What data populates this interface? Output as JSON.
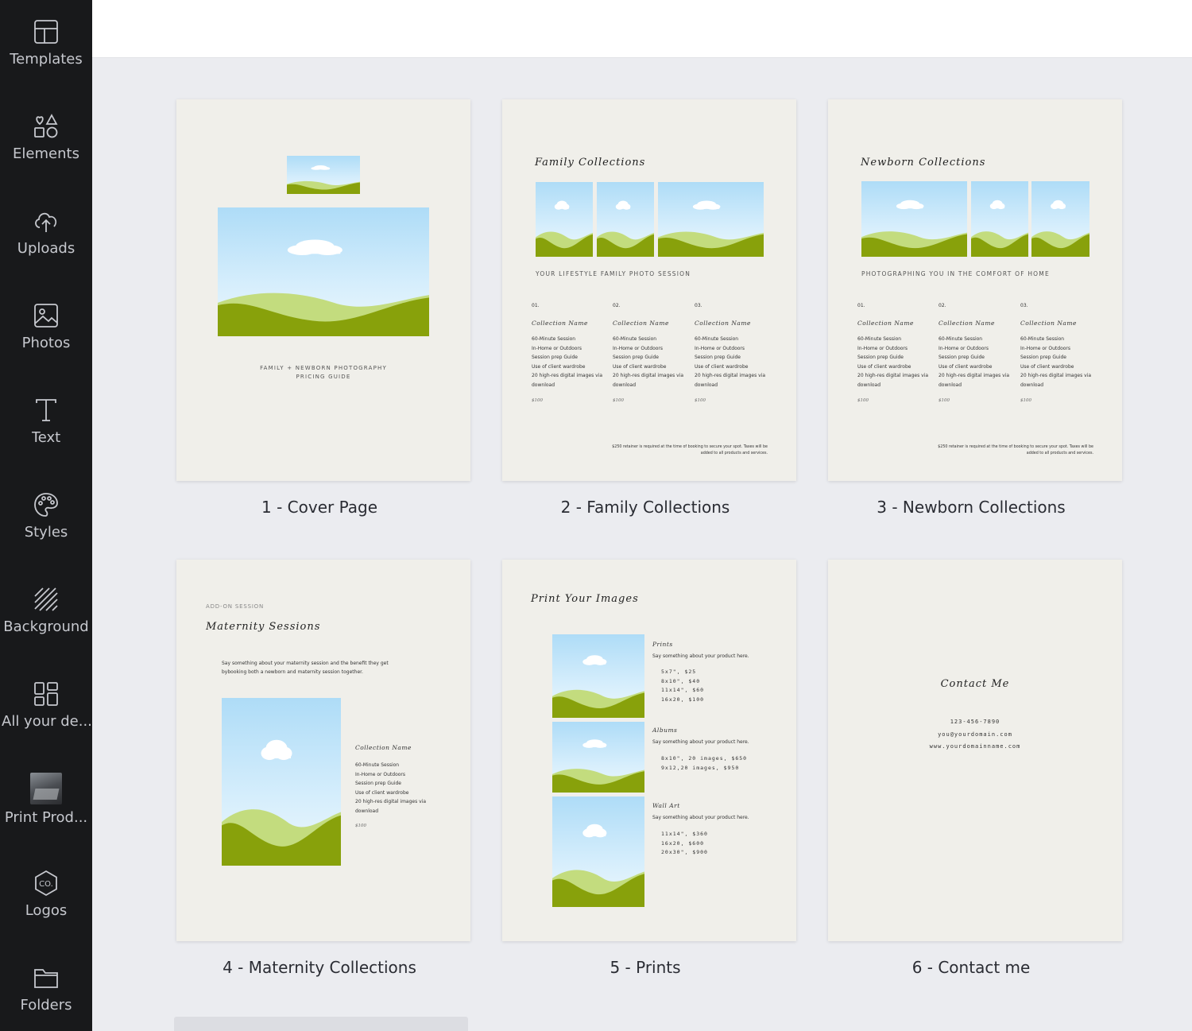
{
  "sidebar": {
    "items": [
      {
        "label": "Templates",
        "icon": "templates-icon"
      },
      {
        "label": "Elements",
        "icon": "elements-icon"
      },
      {
        "label": "Uploads",
        "icon": "upload-cloud-icon"
      },
      {
        "label": "Photos",
        "icon": "photo-icon"
      },
      {
        "label": "Text",
        "icon": "text-icon"
      },
      {
        "label": "Styles",
        "icon": "palette-icon"
      },
      {
        "label": "Background",
        "icon": "background-icon"
      },
      {
        "label": "All your de...",
        "icon": "grid-icon"
      },
      {
        "label": "Print Prod...",
        "icon": "print-product-thumbnail"
      },
      {
        "label": "Logos",
        "icon": "logo-icon"
      },
      {
        "label": "Folders",
        "icon": "folder-icon"
      }
    ]
  },
  "pages": [
    {
      "label": "1 - Cover Page"
    },
    {
      "label": "2 - Family Collections"
    },
    {
      "label": "3 - Newborn Collections"
    },
    {
      "label": "4 - Maternity Collections"
    },
    {
      "label": "5 - Prints"
    },
    {
      "label": "6 - Contact me"
    }
  ],
  "cover": {
    "line1": "FAMILY + NEWBORN PHOTOGRAPHY",
    "line2": "PRICING GUIDE"
  },
  "family": {
    "title": "Family Collections",
    "subtitle": "YOUR LIFESTYLE FAMILY PHOTO SESSION",
    "footnote1": "$250 retainer is required at the time of booking to secure your spot.  Taxes will be",
    "footnote2": "added to all products and services."
  },
  "newborn": {
    "title": "Newborn Collections",
    "subtitle": "PHOTOGRAPHING YOU IN THE COMFORT OF HOME",
    "footnote1": "$250 retainer is required at the time of booking to secure your spot.  Taxes will be",
    "footnote2": "added to all products and services."
  },
  "collection": {
    "nums": [
      "01.",
      "02.",
      "03."
    ],
    "name": "Collection Name",
    "items": [
      "60-Minute Session",
      "In-Home or Outdoors",
      "Session prep Guide",
      "Use of client wardrobe",
      "20 high-res digital images via",
      "download"
    ],
    "price": "$100"
  },
  "maternity": {
    "kicker": "ADD-ON SESSION",
    "title": "Maternity Sessions",
    "desc1": "Say something about your maternity session and the benefit they get",
    "desc2": "bybooking both a newborn and maternity session together."
  },
  "prints": {
    "title": "Print Your Images",
    "say": "Say something about your product here.",
    "products": [
      {
        "name": "Prints",
        "lines": [
          "5x7\", $25",
          "8x10\", $40",
          "11x14\", $60",
          "16x20, $100"
        ]
      },
      {
        "name": "Albums",
        "lines": [
          "8x10\", 20 images, $650",
          "9x12,20 images, $950"
        ]
      },
      {
        "name": "Wall Art",
        "lines": [
          "11x14\", $360",
          "16x20, $600",
          "20x30\", $900"
        ]
      }
    ]
  },
  "contact": {
    "title": "Contact Me",
    "phone": "123-456-7890",
    "email": "you@yourdomain.com",
    "web": "www.yourdomainname.com"
  },
  "colors": {
    "sidebar_bg": "#18191b",
    "canvas_bg": "#ebecf0",
    "page_bg": "#f0efea",
    "hill_light": "#c3dc7e",
    "hill_dark": "#88a10b"
  }
}
